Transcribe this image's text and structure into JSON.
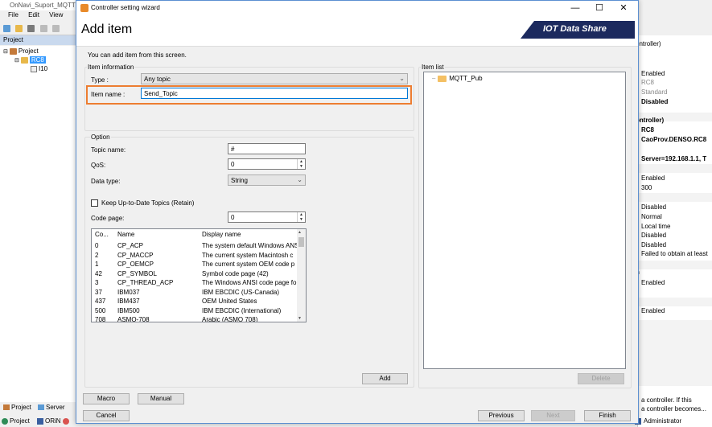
{
  "background_app": {
    "title": "OnNavi_Suport_MQTT",
    "menu": [
      "File",
      "Edit",
      "View"
    ],
    "project_panel_title": "Project",
    "tree": {
      "root": "Project",
      "controller": "RC8",
      "item": "I10"
    },
    "tabs": [
      "Project",
      "Server"
    ],
    "bottom_tabs": [
      "Project",
      "ORiN"
    ],
    "properties": {
      "header": "ontroller)",
      "lines": [
        {
          "text": "Enabled",
          "style": "normal"
        },
        {
          "text": "RC8",
          "style": "gray"
        },
        {
          "text": "Standard",
          "style": "gray"
        },
        {
          "text": "Disabled",
          "style": "bold"
        },
        {
          "text": "ontroller)",
          "style": "bold"
        },
        {
          "text": "RC8",
          "style": "bold"
        },
        {
          "text": "CaoProv.DENSO.RC8",
          "style": "bold"
        },
        {
          "text": "Server=192.168.1.1, T",
          "style": "bold"
        },
        {
          "text": "Enabled",
          "style": "normal"
        },
        {
          "text": "300",
          "style": "normal"
        },
        {
          "text": "Disabled",
          "style": "normal"
        },
        {
          "text": "Normal",
          "style": "normal"
        },
        {
          "text": "Local time",
          "style": "normal"
        },
        {
          "text": "Disabled",
          "style": "normal"
        },
        {
          "text": "Disabled",
          "style": "normal"
        },
        {
          "text": "Failed to obtain at least",
          "style": "normal"
        },
        {
          "text": "n",
          "style": "bold"
        },
        {
          "text": "Enabled",
          "style": "normal"
        },
        {
          "text": "Enabled",
          "style": "normal"
        },
        {
          "text": "a controller. If this",
          "style": "normal"
        },
        {
          "text": "a controller becomes...",
          "style": "normal"
        }
      ],
      "user": "Administrator"
    }
  },
  "dialog": {
    "title": "Controller setting wizard",
    "heading": "Add item",
    "brand": "IOT Data Share",
    "subtitle": "You can add item from this screen.",
    "item_info_group": "Item information",
    "type_label": "Type :",
    "type_value": "Any topic",
    "item_name_label": "Item name :",
    "item_name_value": "Send_Topic",
    "option_group": "Option",
    "topic_name_label": "Topic name:",
    "topic_name_value": "#",
    "qos_label": "QoS:",
    "qos_value": "0",
    "data_type_label": "Data type:",
    "data_type_value": "String",
    "retain_label": "Keep Up-to-Date Topics (Retain)",
    "retain_checked": false,
    "code_page_label": "Code page:",
    "code_page_value": "0",
    "code_table": {
      "headers": [
        "Co...",
        "Name",
        "Display name"
      ],
      "rows": [
        [
          "0",
          "CP_ACP",
          "The system default Windows ANSI"
        ],
        [
          "2",
          "CP_MACCP",
          "The current system Macintosh c"
        ],
        [
          "1",
          "CP_OEMCP",
          "The current system OEM code p"
        ],
        [
          "42",
          "CP_SYMBOL",
          "Symbol code page (42)"
        ],
        [
          "3",
          "CP_THREAD_ACP",
          "The Windows ANSI code page fo"
        ],
        [
          "37",
          "IBM037",
          "IBM EBCDIC (US-Canada)"
        ],
        [
          "437",
          "IBM437",
          "OEM United States"
        ],
        [
          "500",
          "IBM500",
          "IBM EBCDIC (International)"
        ],
        [
          "708",
          "ASMO-708",
          "Arabic (ASMO 708)"
        ]
      ]
    },
    "add_button": "Add",
    "item_list_label": "Item list",
    "item_list": [
      "MQTT_Pub"
    ],
    "delete_button": "Delete",
    "macro_button": "Macro",
    "manual_button": "Manual",
    "cancel_button": "Cancel",
    "previous_button": "Previous",
    "next_button": "Next",
    "finish_button": "Finish"
  }
}
